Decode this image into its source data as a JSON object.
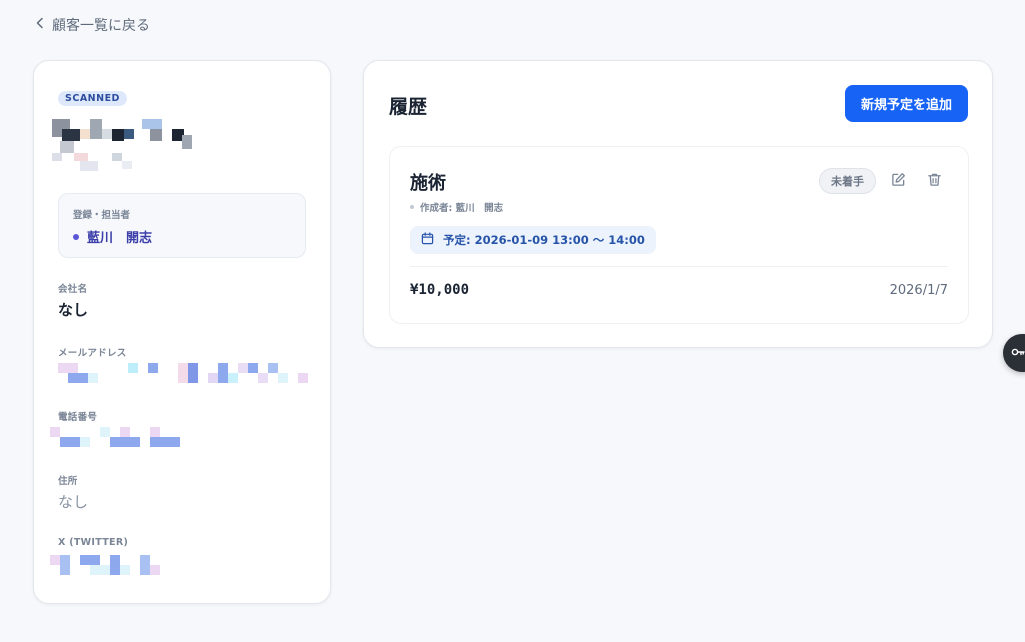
{
  "nav": {
    "back_label": "顧客一覧に戻る"
  },
  "customer": {
    "badge": "SCANNED",
    "owner_label": "登録・担当者",
    "owner_name": "藍川　開志",
    "fields": [
      {
        "label": "会社名",
        "value": "なし"
      },
      {
        "label": "メールアドレス",
        "value": ""
      },
      {
        "label": "電話番号",
        "value": ""
      },
      {
        "label": "住所",
        "value": "なし"
      },
      {
        "label": "X (TWITTER)",
        "value": ""
      }
    ]
  },
  "history": {
    "title": "履歴",
    "add_button_label": "新規予定を追加",
    "entries": [
      {
        "title": "施術",
        "status": "未着手",
        "author": "作成者: 藍川　開志",
        "schedule": "予定: 2026-01-09 13:00 〜 14:00",
        "price": "¥10,000",
        "date": "2026/1/7"
      }
    ]
  },
  "icons": {
    "back": "chevron-left-icon",
    "edit": "pencil-icon",
    "delete": "trash-icon",
    "calendar": "calendar-icon",
    "floating": "key-icon"
  },
  "colors": {
    "primary": "#1663f5",
    "owner_accent": "#3b3ea8",
    "badge_bg": "#dde8fb",
    "schedule_bg": "#edf3fd"
  }
}
